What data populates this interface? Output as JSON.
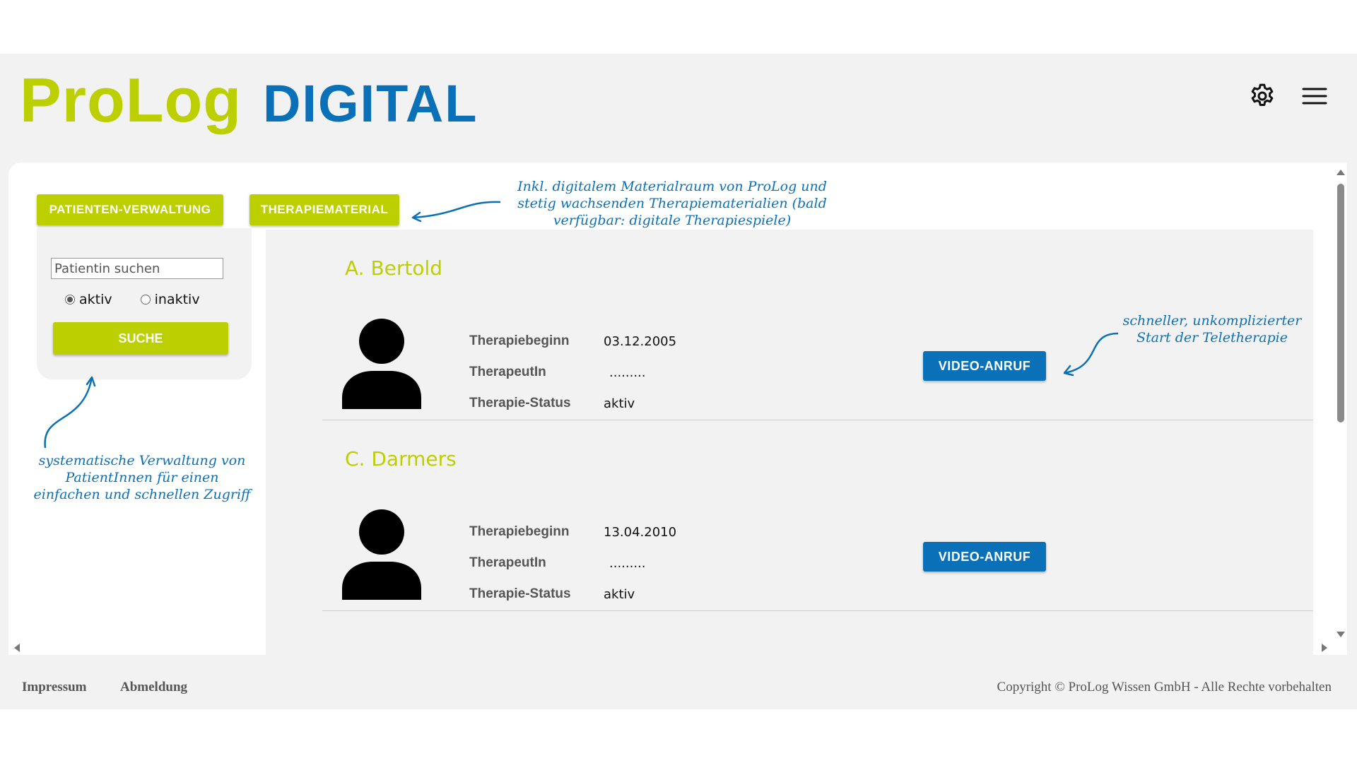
{
  "header": {
    "logo_pro": "ProLog",
    "logo_digital": "DIGITAL"
  },
  "tabs": [
    {
      "label": "PATIENTEN-VERWALTUNG"
    },
    {
      "label": "THERAPIEMATERIAL"
    }
  ],
  "search": {
    "placeholder": "Patientin suchen",
    "radio_active": "aktiv",
    "radio_inactive": "inaktiv",
    "button_label": "SUCHE"
  },
  "field_labels": {
    "start": "Therapiebeginn",
    "therapist": "TherapeutIn",
    "status": "Therapie-Status"
  },
  "patients": [
    {
      "name": "A. Bertold",
      "start": "03.12.2005",
      "therapist": ".........",
      "status": "aktiv",
      "video_button": "VIDEO-ANRUF"
    },
    {
      "name": "C. Darmers",
      "start": "13.04.2010",
      "therapist": ".........",
      "status": "aktiv",
      "video_button": "VIDEO-ANRUF"
    }
  ],
  "annotations": {
    "material": "Inkl. digitalem Materialraum von ProLog und\nstetig wachsenden Therapiematerialien (bald\nverfügbar: digitale Therapiespiele)",
    "teletherapy": "schneller, unkomplizierter\nStart der Teletherapie",
    "patients": "systematische Verwaltung von\nPatientInnen für einen\neinfachen und schnellen Zugriff"
  },
  "footer": {
    "impressum": "Impressum",
    "logout": "Abmeldung",
    "copyright": "Copyright © ProLog Wissen GmbH - Alle Rechte vorbehalten"
  },
  "colors": {
    "brand_green": "#bccf00",
    "brand_blue": "#0a71b9",
    "background": "#f2f2f2"
  },
  "icons": [
    "gear-icon",
    "hamburger-menu-icon",
    "person-avatar-icon",
    "annotation-arrow-icon"
  ]
}
